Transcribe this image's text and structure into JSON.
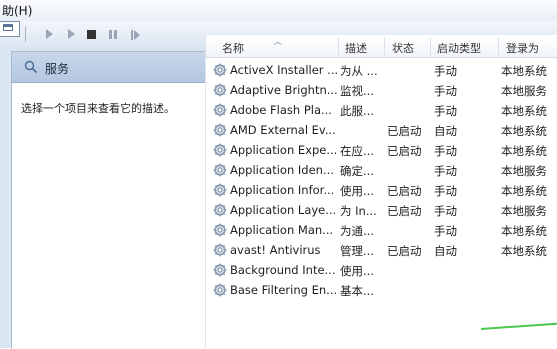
{
  "menubar": {
    "help_label": "助(H)"
  },
  "toolbar": {
    "buttons": [
      "view-icon",
      "start-icon",
      "start-alt-icon",
      "stop-icon",
      "pause-icon",
      "restart-icon"
    ]
  },
  "panel": {
    "title": "服务",
    "description_hint": "选择一个项目来查看它的描述。"
  },
  "table": {
    "columns": {
      "name": "名称",
      "description": "描述",
      "status": "状态",
      "startup_type": "启动类型",
      "logon_as": "登录为"
    },
    "rows": [
      {
        "name": "ActiveX Installer ...",
        "description": "为从 ...",
        "status": "",
        "startup_type": "手动",
        "logon_as": "本地系统"
      },
      {
        "name": "Adaptive Brightn...",
        "description": "监视...",
        "status": "",
        "startup_type": "手动",
        "logon_as": "本地服务"
      },
      {
        "name": "Adobe Flash Pla...",
        "description": "此服...",
        "status": "",
        "startup_type": "手动",
        "logon_as": "本地系统"
      },
      {
        "name": "AMD External Ev...",
        "description": "",
        "status": "已启动",
        "startup_type": "自动",
        "logon_as": "本地系统"
      },
      {
        "name": "Application Expe...",
        "description": "在应...",
        "status": "已启动",
        "startup_type": "手动",
        "logon_as": "本地系统"
      },
      {
        "name": "Application Iden...",
        "description": "确定...",
        "status": "",
        "startup_type": "手动",
        "logon_as": "本地服务"
      },
      {
        "name": "Application Infor...",
        "description": "使用...",
        "status": "已启动",
        "startup_type": "手动",
        "logon_as": "本地系统"
      },
      {
        "name": "Application Laye...",
        "description": "为 In...",
        "status": "已启动",
        "startup_type": "手动",
        "logon_as": "本地服务"
      },
      {
        "name": "Application Man...",
        "description": "为通...",
        "status": "",
        "startup_type": "手动",
        "logon_as": "本地系统"
      },
      {
        "name": "avast! Antivirus",
        "description": "管理...",
        "status": "已启动",
        "startup_type": "自动",
        "logon_as": "本地系统"
      },
      {
        "name": "Background Inte...",
        "description": "使用...",
        "status": "",
        "startup_type": "",
        "logon_as": ""
      },
      {
        "name": "Base Filtering En...",
        "description": "基本...",
        "status": "",
        "startup_type": "",
        "logon_as": ""
      }
    ]
  }
}
